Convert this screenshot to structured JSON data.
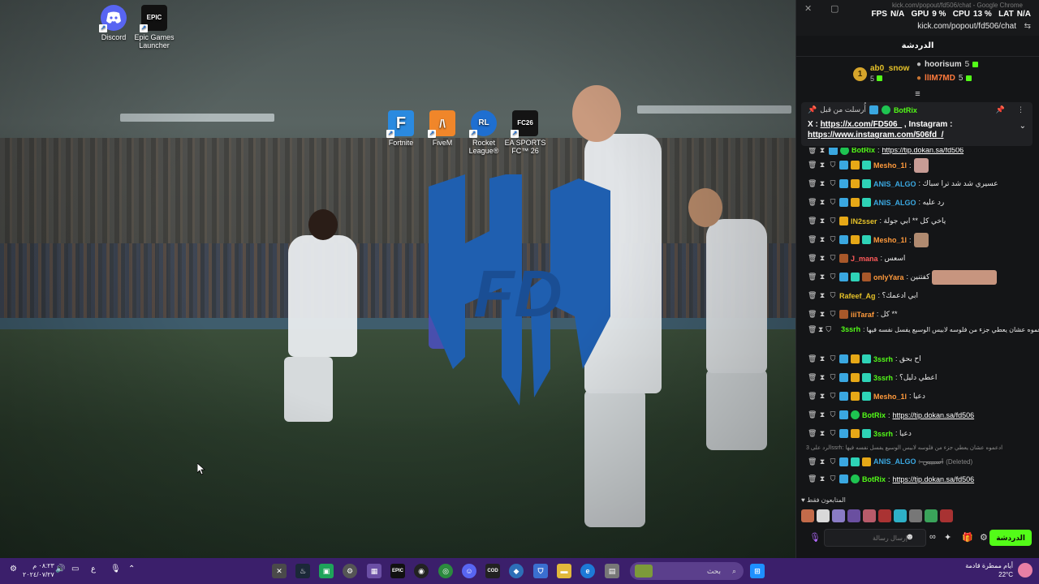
{
  "desktop": {
    "icons": [
      {
        "label": "Discord",
        "icon": "discord-icon",
        "color": "#5865f2",
        "glyph": "D"
      },
      {
        "label": "Epic Games Launcher",
        "icon": "epic-games-icon",
        "color": "#111111",
        "glyph": "EPIC"
      },
      {
        "label": "Fortnite",
        "icon": "fortnite-icon",
        "color": "#2a8ae0",
        "glyph": "F"
      },
      {
        "label": "FiveM",
        "icon": "fivem-icon",
        "color": "#f0862a",
        "glyph": "/\\"
      },
      {
        "label": "Rocket League®",
        "icon": "rocket-league-icon",
        "color": "#1f6fd1",
        "glyph": "RL"
      },
      {
        "label": "EA SPORTS FC™ 26",
        "icon": "ea-fc-icon",
        "color": "#141414",
        "glyph": "FC26"
      }
    ],
    "logo_text": "FD"
  },
  "chat": {
    "window_title": "kick.com/popout/fd506/chat - Google Chrome",
    "url": "kick.com/popout/fd506/chat",
    "overlay": {
      "fps_label": "FPS",
      "fps": "N/A",
      "gpu_label": "GPU",
      "gpu": "9 %",
      "cpu_label": "CPU",
      "cpu": "13 %",
      "lat_label": "LAT",
      "lat": "N/A"
    },
    "header": "الدردشة",
    "leaders": [
      {
        "rank": "1",
        "name": "ab0_snow",
        "count": "5"
      },
      {
        "name": "hoorisum",
        "count": "5"
      },
      {
        "name": "llIM7MD",
        "count": "5"
      }
    ],
    "pinned": {
      "label": "أُرسلت من قبل",
      "user": "BotRix",
      "text_prefix": "X : ",
      "link1": "https://x.com/FD506_",
      "mid": " , Instagram :",
      "link2": "https://www.instagram.com/506fd_/"
    },
    "messages": [
      {
        "user": "BotRix",
        "color": "#53fc18",
        "text": ":",
        "link": "https://tip.dokan.sa/fd506"
      },
      {
        "user": "Mesho_1l",
        "color": "#ff9a3c",
        "text": ":"
      },
      {
        "user": "ANIS_ALGO",
        "color": "#3aa7e0",
        "text": ": عسيري شد شد ترا سباك"
      },
      {
        "user": "ANIS_ALGO",
        "color": "#3aa7e0",
        "text": ": رد عليه"
      },
      {
        "user": "lN2sser",
        "color": "#e6c229",
        "text": ": ياخي كل ** ابي جولة"
      },
      {
        "user": "Mesho_1l",
        "color": "#ff9a3c",
        "text": ":"
      },
      {
        "user": "J_mana",
        "color": "#ff5a5a",
        "text": ": اسعس"
      },
      {
        "user": "onlyYara",
        "color": "#ff9a3c",
        "text": ": كفتنين"
      },
      {
        "user": "Rafeef_Ag",
        "color": "#e6c229",
        "text": ": ابي ادعمك؟"
      },
      {
        "user": "iiiTaraf",
        "color": "#ff9a3c",
        "text": ": كل **"
      },
      {
        "user": "3ssrh",
        "color": "#53fc18",
        "text": ": ادعموه عشان يعطي جزء من فلوسه لابيس الوسيع يفسل نفسه فيها"
      },
      {
        "user": "3ssrh",
        "color": "#53fc18",
        "text": ": اح بحق"
      },
      {
        "user": "3ssrh",
        "color": "#53fc18",
        "text": ": اعطي دليل؟"
      },
      {
        "user": "Mesho_1l",
        "color": "#ff9a3c",
        "text": ": دعيا"
      },
      {
        "user": "BotRix",
        "color": "#53fc18",
        "text": ":",
        "link": "https://tip.dokan.sa/fd506"
      },
      {
        "user": "3ssrh",
        "color": "#53fc18",
        "text": ": دعيا"
      }
    ],
    "reply_note": "الرد على 3ssrh: ادعموه عشان يعطي جزء من فلوسه لابيس الوسيع يفسل نفسه فيها",
    "deleted_msg": {
      "user": "ANIS_ALGO",
      "text": ": اسبيبي",
      "deleted": "(Deleted)"
    },
    "last_msg": {
      "user": "BotRix",
      "link": "https://tip.dokan.sa/fd506"
    },
    "supporters_label": "المتابعون فقط",
    "input_placeholder": "إرسال رسالة",
    "send_label": "الدردشة"
  },
  "taskbar": {
    "clock_time": "٠٨:٢٣ م",
    "clock_date": "٢٠٢٤/٠٧/٢٧",
    "lang": "ع",
    "search_placeholder": "بحث",
    "weather": "أيام ممطرة قادمة",
    "temperature": "22°C"
  }
}
